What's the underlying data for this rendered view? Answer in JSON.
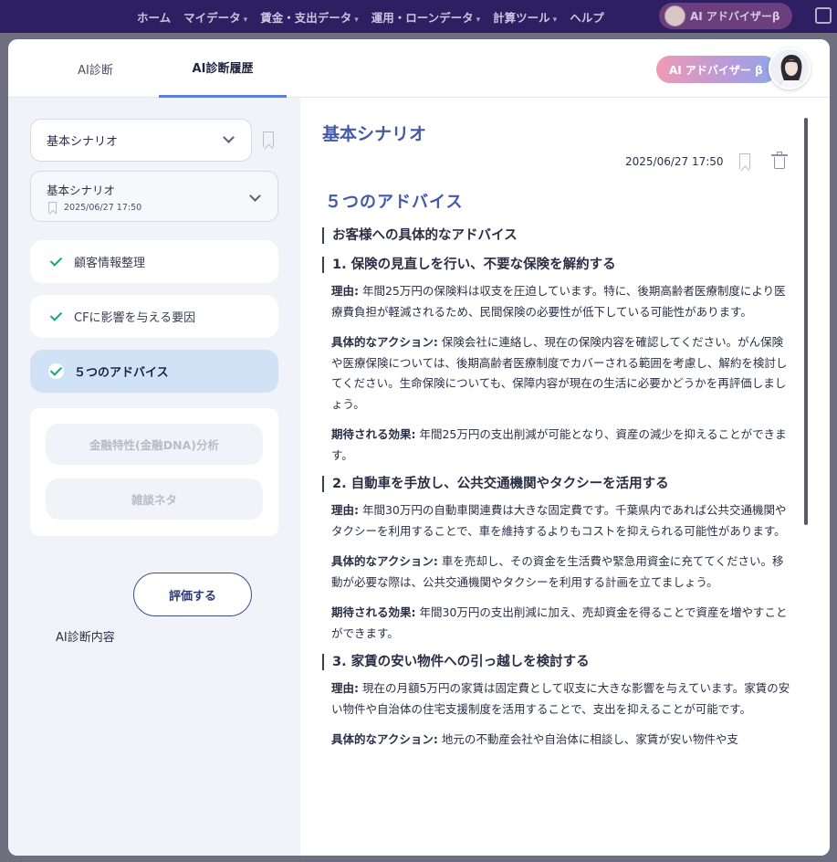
{
  "nav": {
    "items": [
      "ホーム",
      "マイデータ",
      "賃金・支出データ",
      "運用・ローンデータ",
      "計算ツール",
      "ヘルプ"
    ],
    "advisor_label": "AI アドバイザーβ"
  },
  "tabs": {
    "diagnosis": "AI診断",
    "history": "AI診断履歴"
  },
  "ai_button": "AI アドバイザー β",
  "left": {
    "scenario_select": "基本シナリオ",
    "history_select": {
      "title": "基本シナリオ",
      "date": "2025/06/27 17:50"
    },
    "steps": [
      "顧客情報整理",
      "CFに影響を与える要因",
      "５つのアドバイス"
    ],
    "locked": [
      "金融特性(金融DNA)分析",
      "雑談ネタ"
    ],
    "eval_label": "AI診断内容",
    "eval_button": "評価する"
  },
  "content": {
    "title": "基本シナリオ",
    "date": "2025/06/27 17:50",
    "section_title": "５つのアドバイス",
    "intro_heading": "お客様への具体的なアドバイス",
    "advices": [
      {
        "heading": "1. 保険の見直しを行い、不要な保険を解約する",
        "reason_label": "理由:",
        "reason": "年間25万円の保険料は収支を圧迫しています。特に、後期高齢者医療制度により医療費負担が軽減されるため、民間保険の必要性が低下している可能性があります。",
        "action_label": "具体的なアクション:",
        "action": "保険会社に連絡し、現在の保険内容を確認してください。がん保険や医療保険については、後期高齢者医療制度でカバーされる範囲を考慮し、解約を検討してください。生命保険についても、保障内容が現在の生活に必要かどうかを再評価しましょう。",
        "effect_label": "期待される効果:",
        "effect": "年間25万円の支出削減が可能となり、資産の減少を抑えることができます。"
      },
      {
        "heading": "2. 自動車を手放し、公共交通機関やタクシーを活用する",
        "reason_label": "理由:",
        "reason": "年間30万円の自動車関連費は大きな固定費です。千葉県内であれば公共交通機関やタクシーを利用することで、車を維持するよりもコストを抑えられる可能性があります。",
        "action_label": "具体的なアクション:",
        "action": "車を売却し、その資金を生活費や緊急用資金に充ててください。移動が必要な際は、公共交通機関やタクシーを利用する計画を立てましょう。",
        "effect_label": "期待される効果:",
        "effect": "年間30万円の支出削減に加え、売却資金を得ることで資産を増やすことができます。"
      },
      {
        "heading": "3. 家賃の安い物件への引っ越しを検討する",
        "reason_label": "理由:",
        "reason": "現在の月額5万円の家賃は固定費として収支に大きな影響を与えています。家賃の安い物件や自治体の住宅支援制度を活用することで、支出を抑えることが可能です。",
        "action_label": "具体的なアクション:",
        "action": "地元の不動産会社や自治体に相談し、家賃が安い物件や支"
      }
    ]
  }
}
